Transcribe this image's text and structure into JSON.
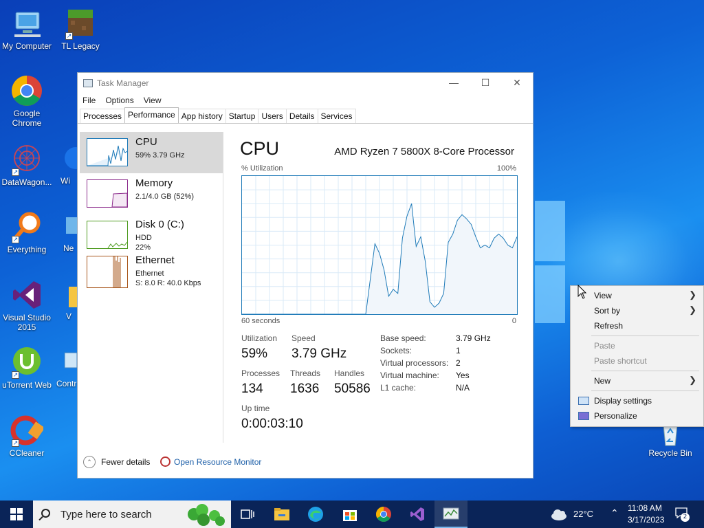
{
  "desktop": {
    "icons": [
      {
        "label": "My Computer"
      },
      {
        "label": "TL Legacy"
      },
      {
        "label": "Google Chrome"
      },
      {
        "label": "DataWagon..."
      },
      {
        "label": "Wi"
      },
      {
        "label": "Everything"
      },
      {
        "label": "Ne"
      },
      {
        "label": "Visual Studio 2015"
      },
      {
        "label": "V"
      },
      {
        "label": "uTorrent Web"
      },
      {
        "label": "Contr"
      },
      {
        "label": "CCleaner"
      },
      {
        "label": "Recycle Bin"
      }
    ]
  },
  "taskmanager": {
    "title": "Task Manager",
    "menu": [
      "File",
      "Options",
      "View"
    ],
    "tabs": [
      "Processes",
      "Performance",
      "App history",
      "Startup",
      "Users",
      "Details",
      "Services"
    ],
    "active_tab": "Performance",
    "sidebar": [
      {
        "name": "CPU",
        "sub1": "59%  3.79 GHz",
        "sub2": "",
        "color": "#1e7ab8"
      },
      {
        "name": "Memory",
        "sub1": "2.1/4.0 GB (52%)",
        "sub2": "",
        "color": "#8b2a8b"
      },
      {
        "name": "Disk 0 (C:)",
        "sub1": "HDD",
        "sub2": "22%",
        "color": "#4d9a1e"
      },
      {
        "name": "Ethernet",
        "sub1": "Ethernet",
        "sub2": "S: 8.0  R: 40.0 Kbps",
        "color": "#a7551a"
      }
    ],
    "main": {
      "title": "CPU",
      "processor": "AMD Ryzen 7 5800X 8-Core Processor",
      "util_label": "% Utilization",
      "util_max": "100%",
      "graph_left": "60 seconds",
      "graph_right": "0",
      "stats": {
        "utilization_label": "Utilization",
        "utilization": "59%",
        "speed_label": "Speed",
        "speed": "3.79 GHz",
        "processes_label": "Processes",
        "processes": "134",
        "threads_label": "Threads",
        "threads": "1636",
        "handles_label": "Handles",
        "handles": "50586",
        "uptime_label": "Up time",
        "uptime": "0:00:03:10"
      },
      "specs": [
        {
          "k": "Base speed:",
          "v": "3.79 GHz"
        },
        {
          "k": "Sockets:",
          "v": "1"
        },
        {
          "k": "Virtual processors:",
          "v": "2"
        },
        {
          "k": "Virtual machine:",
          "v": "Yes"
        },
        {
          "k": "L1 cache:",
          "v": "N/A"
        }
      ]
    },
    "footer": {
      "fewer": "Fewer details",
      "resource_monitor": "Open Resource Monitor"
    }
  },
  "chart_data": {
    "type": "area",
    "title": "",
    "xlabel": "",
    "ylabel": "% Utilization",
    "xlim": [
      60,
      0
    ],
    "ylim": [
      0,
      100
    ],
    "grid": true,
    "series": [
      {
        "x": [
          60,
          33,
          31,
          30,
          29,
          28,
          27,
          26,
          25,
          24,
          23,
          22,
          21,
          20,
          19,
          18,
          17,
          16,
          15,
          14,
          13,
          12,
          11,
          10,
          9,
          8,
          7,
          6,
          5,
          4,
          3,
          2,
          1,
          0
        ],
        "values": [
          0,
          0,
          51,
          44,
          32,
          13,
          18,
          15,
          55,
          71,
          80,
          49,
          56,
          38,
          9,
          5,
          8,
          15,
          52,
          58,
          68,
          72,
          69,
          65,
          56,
          48,
          50,
          48,
          55,
          58,
          55,
          50,
          48,
          56
        ]
      }
    ],
    "color": "#1e7ab8"
  },
  "context_menu": {
    "items": [
      {
        "label": "View",
        "arrow": true,
        "disabled": false
      },
      {
        "label": "Sort by",
        "arrow": true,
        "disabled": false
      },
      {
        "label": "Refresh",
        "arrow": false,
        "disabled": false
      },
      {
        "label": "Paste",
        "arrow": false,
        "disabled": true
      },
      {
        "label": "Paste shortcut",
        "arrow": false,
        "disabled": true
      },
      {
        "label": "New",
        "arrow": true,
        "disabled": false
      },
      {
        "label": "Display settings",
        "arrow": false,
        "disabled": false
      },
      {
        "label": "Personalize",
        "arrow": false,
        "disabled": false
      }
    ]
  },
  "taskbar": {
    "search_placeholder": "Type here to search",
    "weather": "22°C",
    "time": "11:08 AM",
    "date": "3/17/2023",
    "notification_count": "2"
  }
}
